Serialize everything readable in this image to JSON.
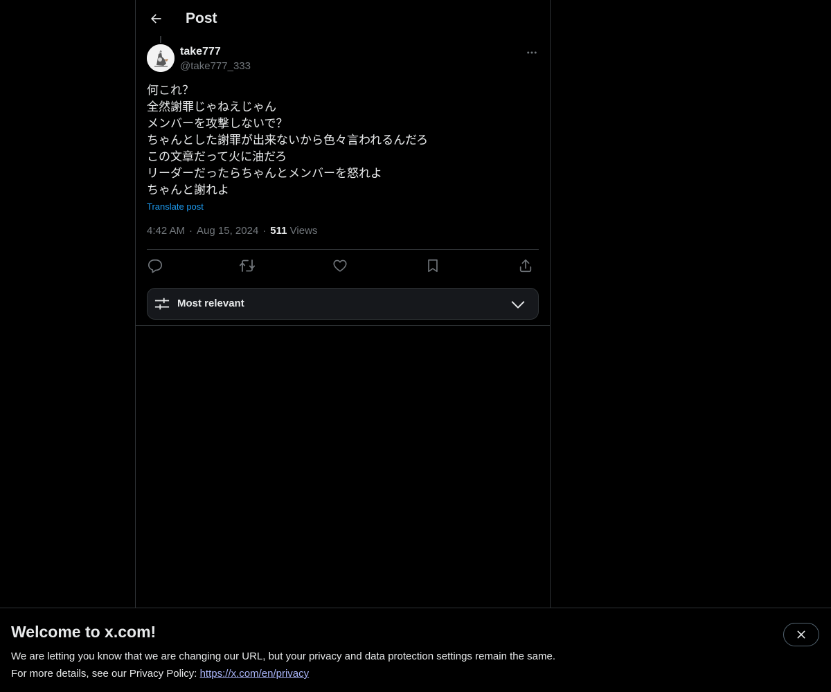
{
  "header": {
    "title": "Post"
  },
  "post": {
    "author": {
      "display_name": "take777",
      "handle": "@take777_333"
    },
    "lines": [
      "何これ？",
      "全然謝罪じゃねえじゃん",
      "メンバーを攻撃しないで？",
      "ちゃんとした謝罪が出来ないから色々言われるんだろ",
      "この文章だって火に油だろ",
      "リーダーだったらちゃんとメンバーを怒れよ",
      "ちゃんと謝れよ"
    ],
    "translate_label": "Translate post",
    "time": "4:42 AM",
    "date": "Aug 15, 2024",
    "views_count": "511",
    "views_label": "Views"
  },
  "sort": {
    "label": "Most relevant"
  },
  "banner": {
    "title": "Welcome to x.com!",
    "line1": "We are letting you know that we are changing our URL, but your privacy and data protection settings remain the same.",
    "line2_prefix": "For more details, see our Privacy Policy: ",
    "link_text": "https://x.com/en/privacy"
  },
  "colors": {
    "background": "#000000",
    "text": "#e7e9ea",
    "muted": "#71767b",
    "accent": "#1d9bf0",
    "border": "#2f3336"
  },
  "icons": {
    "back": "arrow-left-icon",
    "more": "ellipsis-icon",
    "reply": "speech-bubble-icon",
    "repost": "repost-arrows-icon",
    "like": "heart-icon",
    "bookmark": "bookmark-icon",
    "share": "share-upload-icon",
    "sort": "sliders-icon",
    "chevron": "chevron-down-icon",
    "close": "close-icon"
  }
}
